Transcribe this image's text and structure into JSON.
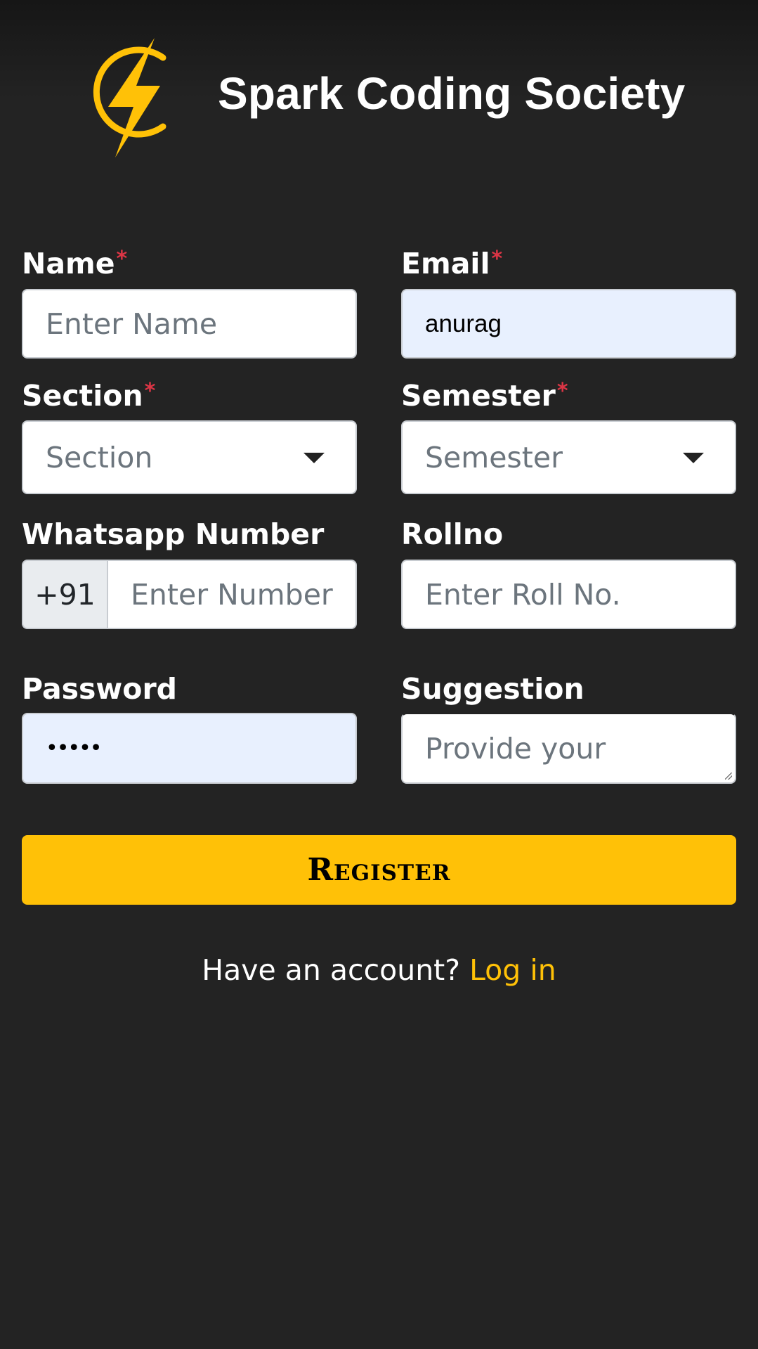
{
  "brand": {
    "title": "Spark Coding Society",
    "accent_color": "#ffc107",
    "logo_icon": "lightning-bolt-logo"
  },
  "form": {
    "required_mark": "*",
    "name": {
      "label": "Name",
      "placeholder": "Enter Name",
      "value": "",
      "required": true
    },
    "email": {
      "label": "Email",
      "placeholder": "",
      "value": "anurag",
      "required": true
    },
    "section": {
      "label": "Section",
      "selected": "Section",
      "required": true
    },
    "semester": {
      "label": "Semester",
      "selected": "Semester",
      "required": true
    },
    "whatsapp": {
      "label": "Whatsapp Number",
      "prefix": "+91",
      "placeholder": "Enter Number",
      "value": ""
    },
    "rollno": {
      "label": "Rollno",
      "placeholder": "Enter Roll No.",
      "value": ""
    },
    "password": {
      "label": "Password",
      "masked_value": "•••••"
    },
    "suggestion": {
      "label": "Suggestion",
      "placeholder": "Provide your",
      "value": ""
    },
    "register_label": "Register"
  },
  "footer": {
    "prompt": "Have an account? ",
    "login_label": "Log in"
  }
}
